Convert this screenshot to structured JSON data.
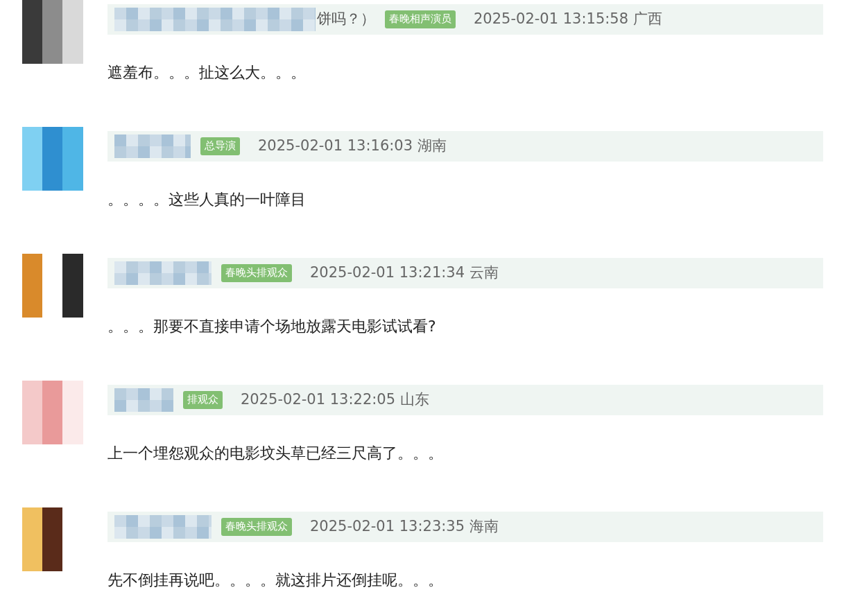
{
  "comments": [
    {
      "name_tail": "饼吗？）",
      "badge": "春晚相声演员",
      "meta": "2025-02-01 13:15:58 广西",
      "text": "遮羞布。。。扯这么大。。。"
    },
    {
      "badge": "总导演",
      "meta": "2025-02-01 13:16:03 湖南",
      "text": "。。。。这些人真的一叶障目"
    },
    {
      "badge": "春晚头排观众",
      "meta": "2025-02-01 13:21:34 云南",
      "text": "。。。那要不直接申请个场地放露天电影试试看?"
    },
    {
      "badge": "排观众",
      "meta": "2025-02-01 13:22:05 山东",
      "text": "上一个埋怨观众的电影坟头草已经三尺高了。。。"
    },
    {
      "badge": "春晚头排观众",
      "meta": "2025-02-01 13:23:35 海南",
      "text": "先不倒挂再说吧。。。。就这排片还倒挂呢。。。"
    }
  ]
}
